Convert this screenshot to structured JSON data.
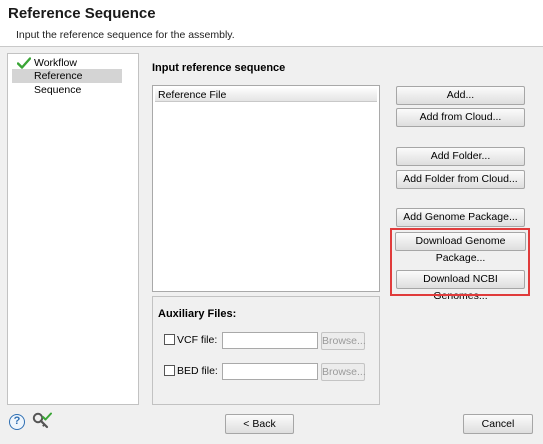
{
  "header": {
    "title": "Reference Sequence",
    "subtitle": "Input the reference sequence for the assembly."
  },
  "nav": {
    "items": [
      {
        "label": "Workflow",
        "done": true
      },
      {
        "label": "Reference Sequence",
        "selected": true
      }
    ]
  },
  "main": {
    "title": "Input reference sequence",
    "list_header": "Reference File"
  },
  "buttons": {
    "add": "Add...",
    "add_cloud": "Add from Cloud...",
    "add_folder": "Add Folder...",
    "add_folder_cloud": "Add Folder from Cloud...",
    "add_genome_package": "Add Genome Package...",
    "download_genome_package": "Download Genome Package...",
    "download_ncbi": "Download NCBI Genomes..."
  },
  "auxiliary": {
    "title": "Auxiliary Files:",
    "vcf_label": "VCF file:",
    "bed_label": "BED file:",
    "browse": "Browse..."
  },
  "footer": {
    "back": "< Back",
    "cancel": "Cancel",
    "help": "?"
  },
  "colors": {
    "highlight": "#e03b3b",
    "check": "#3aa536"
  }
}
